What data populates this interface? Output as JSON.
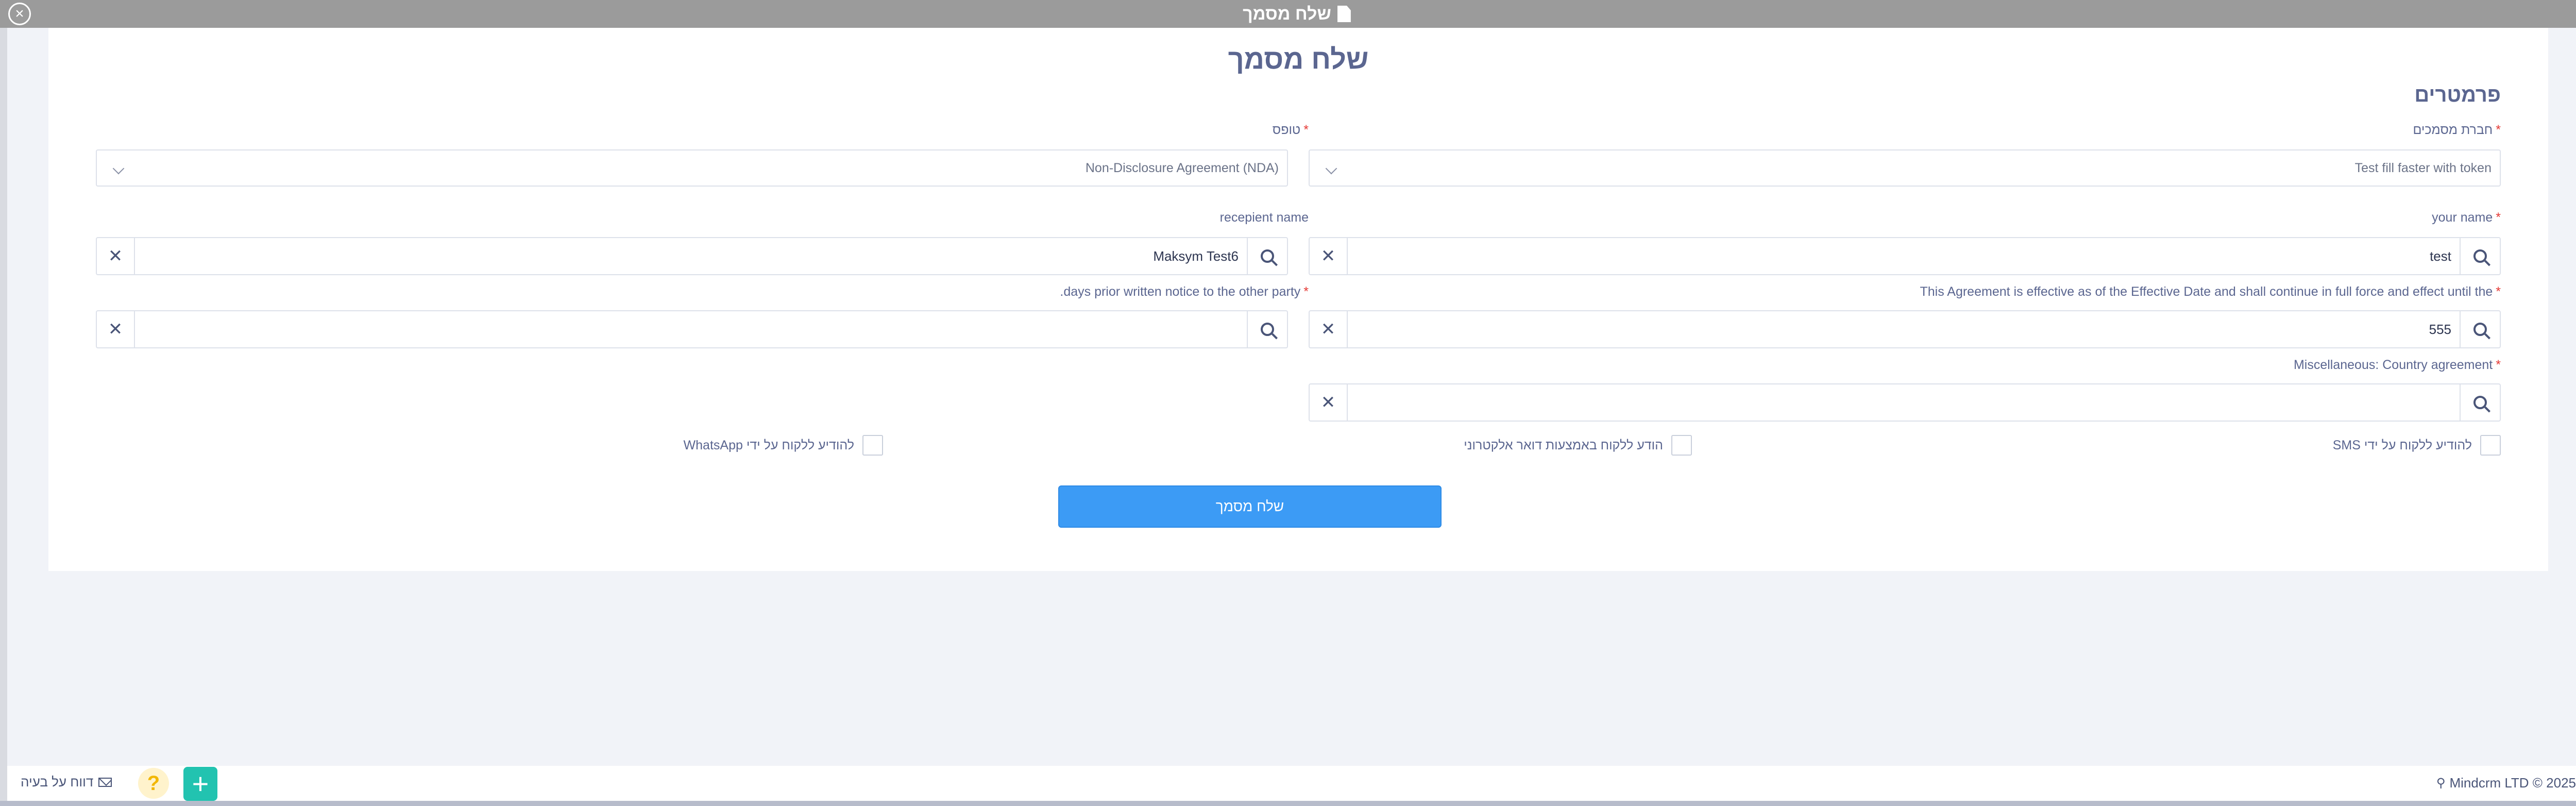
{
  "window": {
    "title": "שלח מסמך",
    "close_icon": "close-circle-icon",
    "title_icon": "file-icon"
  },
  "page": {
    "title": "שלח מסמך",
    "section_title": "פרמטרים"
  },
  "fields": {
    "company": {
      "label": "חברת מסמכים",
      "required": "*",
      "value": "Test fill faster with token"
    },
    "template": {
      "label": "טופס",
      "required": "*",
      "value": "Non-Disclosure Agreement (NDA)"
    },
    "your_name": {
      "label": "your name",
      "required": "*",
      "value": "test"
    },
    "recipient_name": {
      "label": "recepient name",
      "value": "Maksym Test6"
    },
    "effective_until": {
      "label": "This Agreement is effective as of the Effective Date and shall continue in full force and effect until the",
      "required": "*",
      "value": "555"
    },
    "notice_days": {
      "label": "days prior written notice to the other party.",
      "required": "*",
      "value": ""
    },
    "country_agreement": {
      "label": "Miscellaneous: Country agreement",
      "required": "*",
      "value": ""
    }
  },
  "notifications": {
    "sms": "להודיע ללקוח על ידי SMS",
    "email": "הודע ללקוח באמצעות דואר אלקטרוני",
    "whatsapp": "להודיע ללקוח על ידי WhatsApp"
  },
  "submit_label": "שלח מסמך",
  "footer": {
    "report_label": "דווח על בעיה",
    "help_glyph": "?",
    "plus_glyph": "+",
    "copyright": "Mindcrm LTD © 2025"
  },
  "colors": {
    "accent": "#3c9bf5",
    "title": "#5b6690",
    "required": "#e53935",
    "fab": "#22c3b0",
    "help_bg": "#fff3cc",
    "help_fg": "#f2b705"
  }
}
